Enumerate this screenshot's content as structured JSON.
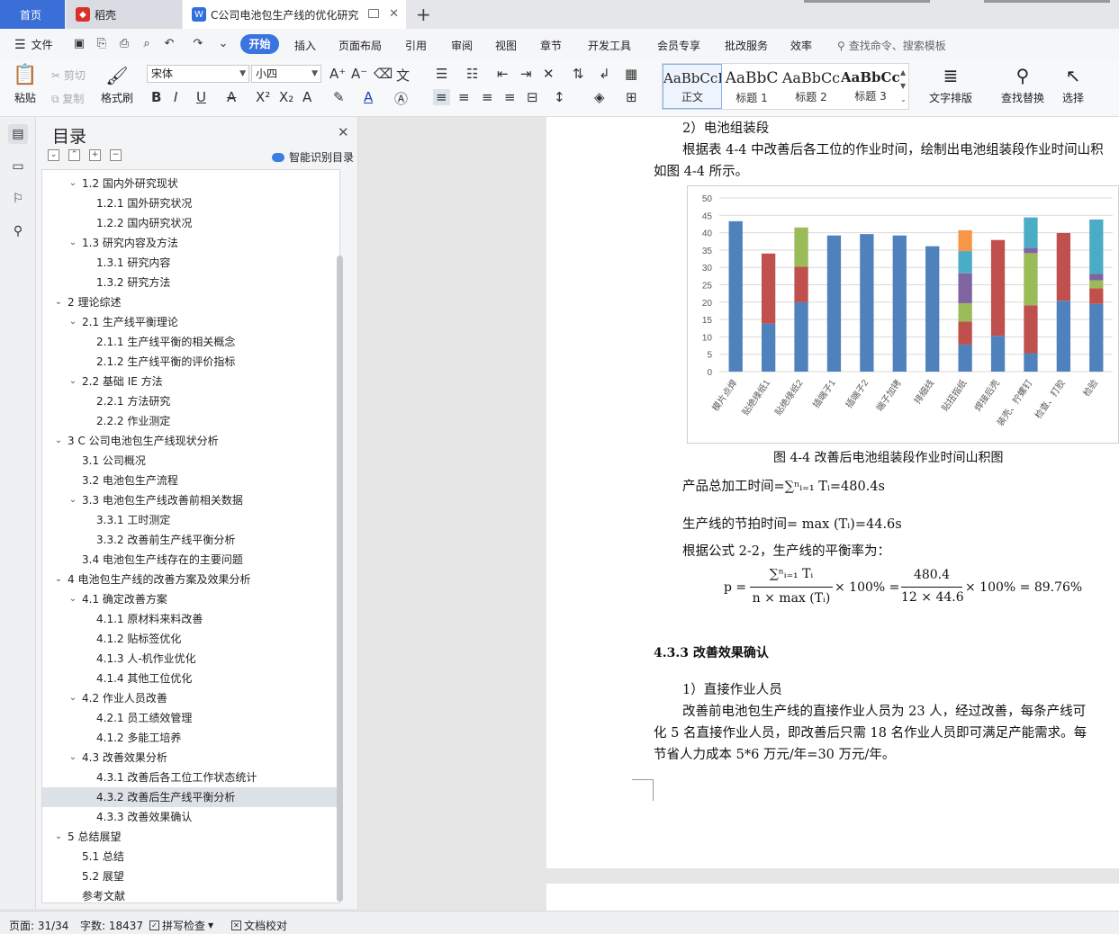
{
  "tabs": {
    "home": "首页",
    "daoke": "稻壳",
    "doc": "C公司电池包生产线的优化研究"
  },
  "menu": {
    "file": "文件",
    "items": [
      "开始",
      "插入",
      "页面布局",
      "引用",
      "审阅",
      "视图",
      "章节",
      "开发工具",
      "会员专享",
      "批改服务",
      "效率"
    ],
    "search": "查找命令、搜索模板"
  },
  "ribbon": {
    "paste": "粘贴",
    "cut": "剪切",
    "copy": "复制",
    "format_painter": "格式刷",
    "font_name": "宋体",
    "font_size": "小四",
    "styles": [
      {
        "sample": "AaBbCcI",
        "name": "正文"
      },
      {
        "sample": "AaBbC",
        "name": "标题 1"
      },
      {
        "sample": "AaBbCc",
        "name": "标题 2"
      },
      {
        "sample": "AaBbCcl",
        "name": "标题 3"
      }
    ],
    "text_layout": "文字排版",
    "find_replace": "查找替换",
    "select": "选择"
  },
  "toc": {
    "title": "目录",
    "smart": "智能识别目录",
    "items": [
      {
        "label": "1.2 国内外研究现状",
        "level": 2,
        "arrow": true
      },
      {
        "label": "1.2.1 国外研究状况",
        "level": 3
      },
      {
        "label": "1.2.2 国内研究状况",
        "level": 3
      },
      {
        "label": "1.3 研究内容及方法",
        "level": 2,
        "arrow": true
      },
      {
        "label": "1.3.1 研究内容",
        "level": 3
      },
      {
        "label": "1.3.2 研究方法",
        "level": 3
      },
      {
        "label": "2 理论综述",
        "level": 1,
        "arrow": true
      },
      {
        "label": "2.1 生产线平衡理论",
        "level": 2,
        "arrow": true
      },
      {
        "label": "2.1.1 生产线平衡的相关概念",
        "level": 3
      },
      {
        "label": "2.1.2 生产线平衡的评价指标",
        "level": 3
      },
      {
        "label": "2.2 基础 IE 方法",
        "level": 2,
        "arrow": true
      },
      {
        "label": "2.2.1 方法研究",
        "level": 3
      },
      {
        "label": "2.2.2 作业测定",
        "level": 3
      },
      {
        "label": "3 C 公司电池包生产线现状分析",
        "level": 1,
        "arrow": true
      },
      {
        "label": "3.1 公司概况",
        "level": 2
      },
      {
        "label": "3.2 电池包生产流程",
        "level": 2
      },
      {
        "label": "3.3 电池包生产线改善前相关数据",
        "level": 2,
        "arrow": true
      },
      {
        "label": "3.3.1 工时测定",
        "level": 3
      },
      {
        "label": "3.3.2 改善前生产线平衡分析",
        "level": 3
      },
      {
        "label": "3.4 电池包生产线存在的主要问题",
        "level": 2
      },
      {
        "label": "4 电池包生产线的改善方案及效果分析",
        "level": 1,
        "arrow": true
      },
      {
        "label": "4.1 确定改善方案",
        "level": 2,
        "arrow": true
      },
      {
        "label": "4.1.1 原材料来料改善",
        "level": 3
      },
      {
        "label": "4.1.2 贴标签优化",
        "level": 3
      },
      {
        "label": "4.1.3 人-机作业优化",
        "level": 3
      },
      {
        "label": "4.1.4 其他工位优化",
        "level": 3
      },
      {
        "label": "4.2 作业人员改善",
        "level": 2,
        "arrow": true
      },
      {
        "label": "4.2.1 员工绩效管理",
        "level": 3
      },
      {
        "label": "4.1.2 多能工培养",
        "level": 3
      },
      {
        "label": "4.3 改善效果分析",
        "level": 2,
        "arrow": true
      },
      {
        "label": "4.3.1 改善后各工位工作状态统计",
        "level": 3
      },
      {
        "label": "4.3.2 改善后生产线平衡分析",
        "level": 3,
        "selected": true
      },
      {
        "label": "4.3.3 改善效果确认",
        "level": 3
      },
      {
        "label": "5 总结展望",
        "level": 1,
        "arrow": true
      },
      {
        "label": "5.1 总结",
        "level": 2
      },
      {
        "label": "5.2 展望",
        "level": 2
      },
      {
        "label": "参考文献",
        "level": 2
      }
    ]
  },
  "status": {
    "page": "页面: 31/34",
    "words": "字数: 18437",
    "spell": "拼写检查",
    "proof": "文档校对"
  },
  "doc": {
    "sec_title": "2）电池组装段",
    "para1_line1": "根据表 4-4 中改善后各工位的作业时间，绘制出电池组装段作业时间山积",
    "para1_line2": "如图 4-4 所示。",
    "figure_caption": "图 4-4  改善后电池组装段作业时间山积图",
    "total_time": "产品总加工时间=∑ⁿᵢ₌₁ Tᵢ=480.4s",
    "takt_time": "生产线的节拍时间= max (Tᵢ)=44.6s",
    "formula_intro": "根据公式 2-2，生产线的平衡率为：",
    "formula_p": "p =",
    "formula_num1": "∑ⁿᵢ₌₁ Tᵢ",
    "formula_den1": "n × max (Tᵢ)",
    "formula_mult1": "× 100% =",
    "formula_num2": "480.4",
    "formula_den2": "12 × 44.6",
    "formula_mult2": "× 100% = 89.76%",
    "heading_433": "4.3.3 改善效果确认",
    "item1": "1）直接作业人员",
    "para2_line1": "改善前电池包生产线的直接作业人员为 23 人，经过改善，每条产线可",
    "para2_line2": "化 5 名直接作业人员，即改善后只需 18 名作业人员即可满足产能需求。每",
    "para2_line3": "节省人力成本 5*6 万元/年=30 万元/年。"
  },
  "chart_data": {
    "type": "bar",
    "stacked": true,
    "categories": [
      "模片点焊",
      "贴绝缘纸1",
      "贴绝缘纸2",
      "插端子1",
      "插端子2",
      "端子加铐",
      "排细线",
      "贴扭指纸",
      "焊接后壳",
      "装壳、拧螺钉",
      "检查、打胶",
      "检验"
    ],
    "ylim": [
      0,
      50
    ],
    "yticks": [
      0,
      5,
      10,
      15,
      20,
      25,
      30,
      35,
      40,
      45,
      50
    ],
    "grid": true,
    "legend": "none",
    "colors": [
      "#4f81bd",
      "#c0504d",
      "#9bbb59",
      "#8064a2",
      "#4bacc6",
      "#f79646"
    ],
    "series": [
      {
        "color": "#4f81bd",
        "values": [
          43.3,
          13.8,
          20.0,
          39.2,
          39.6,
          39.2,
          36.1,
          7.8,
          10.3,
          5.3,
          20.4,
          19.5
        ]
      },
      {
        "color": "#c0504d",
        "values": [
          0,
          20.2,
          10.2,
          0,
          0,
          0,
          0,
          6.6,
          27.6,
          13.8,
          19.5,
          4.5
        ]
      },
      {
        "color": "#9bbb59",
        "values": [
          0,
          0,
          11.3,
          0,
          0,
          0,
          0,
          5.3,
          0,
          15.0,
          0,
          2.3
        ]
      },
      {
        "color": "#8064a2",
        "values": [
          0,
          0,
          0,
          0,
          0,
          0,
          0,
          8.6,
          0,
          1.5,
          0,
          1.8
        ]
      },
      {
        "color": "#4bacc6",
        "values": [
          0,
          0,
          0,
          0,
          0,
          0,
          0,
          6.4,
          0,
          8.8,
          0,
          15.7
        ]
      },
      {
        "color": "#f79646",
        "values": [
          0,
          0,
          0,
          0,
          0,
          0,
          0,
          6.0,
          0,
          0,
          0,
          0
        ]
      }
    ]
  }
}
